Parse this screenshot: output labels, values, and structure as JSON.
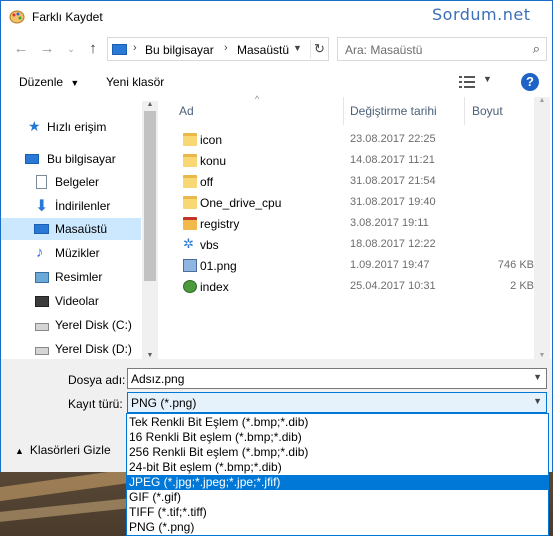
{
  "window": {
    "title": "Farklı Kaydet"
  },
  "watermark": "Sordum.net",
  "address": {
    "crumbs": [
      "Bu bilgisayar",
      "Masaüstü"
    ],
    "separator": "›"
  },
  "search": {
    "placeholder": "Ara: Masaüstü"
  },
  "toolbar": {
    "organize": "Düzenle",
    "new_folder": "Yeni klasör",
    "help": "?"
  },
  "nav_items": [
    {
      "label": "Hızlı erişim",
      "icon": "quick-access-star-icon"
    },
    {
      "label": "Bu bilgisayar",
      "icon": "computer-icon"
    },
    {
      "label": "Belgeler",
      "icon": "documents-icon"
    },
    {
      "label": "İndirilenler",
      "icon": "downloads-arrow-icon"
    },
    {
      "label": "Masaüstü",
      "icon": "desktop-icon",
      "selected": true
    },
    {
      "label": "Müzikler",
      "icon": "music-note-icon"
    },
    {
      "label": "Resimler",
      "icon": "pictures-icon"
    },
    {
      "label": "Videolar",
      "icon": "videos-icon"
    },
    {
      "label": "Yerel Disk (C:)",
      "icon": "drive-c-icon"
    },
    {
      "label": "Yerel Disk (D:)",
      "icon": "drive-d-icon"
    }
  ],
  "columns": {
    "name": "Ad",
    "modified": "Değiştirme tarihi",
    "size": "Boyut"
  },
  "files": [
    {
      "name": "icon",
      "modified": "23.08.2017 22:25",
      "size": "",
      "type": "folder"
    },
    {
      "name": "konu",
      "modified": "14.08.2017 11:21",
      "size": "",
      "type": "folder"
    },
    {
      "name": "off",
      "modified": "31.08.2017 21:54",
      "size": "",
      "type": "folder"
    },
    {
      "name": "One_drive_cpu",
      "modified": "31.08.2017 19:40",
      "size": "",
      "type": "folder"
    },
    {
      "name": "registry",
      "modified": "3.08.2017 19:11",
      "size": "",
      "type": "registry-folder"
    },
    {
      "name": "vbs",
      "modified": "18.08.2017 12:22",
      "size": "",
      "type": "vbs-folder"
    },
    {
      "name": "01.png",
      "modified": "1.09.2017 19:47",
      "size": "746 KB",
      "type": "image"
    },
    {
      "name": "index",
      "modified": "25.04.2017 10:31",
      "size": "2 KB",
      "type": "web"
    }
  ],
  "form": {
    "filename_label": "Dosya adı:",
    "filename_value": "Adsız.png",
    "type_label": "Kayıt türü:",
    "type_value": "PNG (*.png)"
  },
  "hide_folders": "Klasörleri Gizle",
  "type_options": [
    "Tek Renkli Bit Eşlem (*.bmp;*.dib)",
    "16 Renkli Bit eşlem (*.bmp;*.dib)",
    "256 Renkli Bit eşlem (*.bmp;*.dib)",
    "24-bit Bit eşlem (*.bmp;*.dib)",
    "JPEG (*.jpg;*.jpeg;*.jpe;*.jfif)",
    "GIF (*.gif)",
    "TIFF (*.tif;*.tiff)",
    "PNG (*.png)"
  ],
  "selected_option_index": 4,
  "colors": {
    "accent": "#0078d7",
    "selection": "#cce8ff",
    "folder": "#f8d775"
  }
}
